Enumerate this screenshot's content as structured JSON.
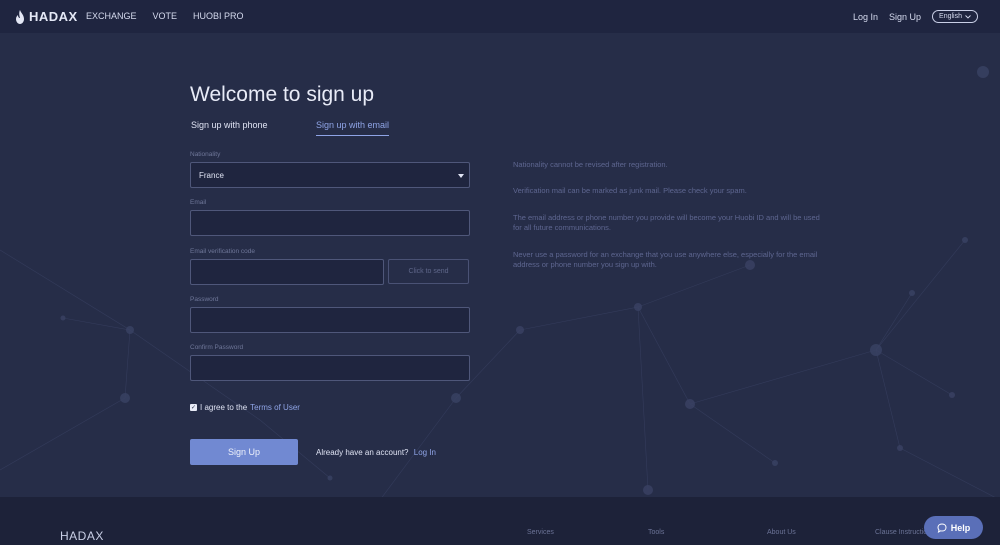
{
  "brand": {
    "logo_text": "HADAX",
    "footer_logo": "HADAX"
  },
  "nav": {
    "links": [
      "EXCHANGE",
      "VOTE",
      "HUOBI PRO"
    ],
    "login": "Log In",
    "signup": "Sign Up",
    "language": "English"
  },
  "form": {
    "title": "Welcome to sign up",
    "tab_phone": "Sign up with phone",
    "tab_email": "Sign up with email",
    "nationality_label": "Nationality",
    "nationality_value": "France",
    "email_label": "Email",
    "email_value": "",
    "code_label": "Email verification code",
    "code_value": "",
    "send_label": "Click to send",
    "password_label": "Password",
    "password_value": "",
    "confirm_label": "Confirm Password",
    "confirm_value": "",
    "agree_text": "I agree to the",
    "terms_link": "Terms of User",
    "agree_checked": true,
    "submit_label": "Sign Up",
    "already_text": "Already have an account?",
    "login_link": "Log In"
  },
  "notes": [
    "Nationality cannot be revised after registration.",
    "Verification mail can be marked as junk mail. Please check your spam.",
    "The email address or phone number you provide will become your Huobi ID and will be used for all future communications.",
    "Never use a password for an exchange that you use anywhere else, especially for the email address or phone number you sign up with."
  ],
  "footer": {
    "services": "Services",
    "tools": "Tools",
    "about": "About Us",
    "clause": "Clause Instruction"
  },
  "help": {
    "label": "Help"
  },
  "colors": {
    "background": "#262d48",
    "nav_bg": "#1f2540",
    "accent": "#8fa4e6",
    "button": "#7189d2",
    "help": "#5a6fb8"
  }
}
